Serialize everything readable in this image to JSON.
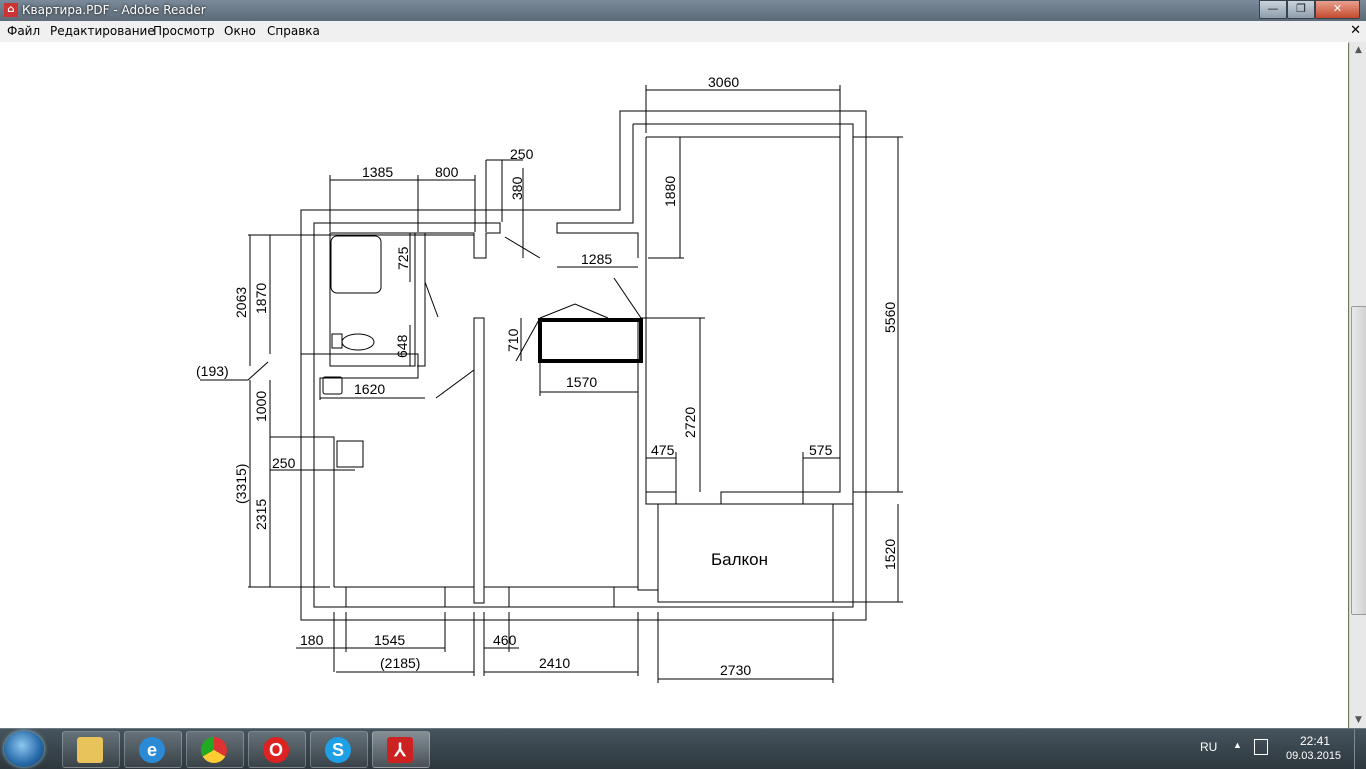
{
  "window": {
    "title": "Квартира.PDF - Adobe Reader",
    "icon": "pdf-icon"
  },
  "window_controls": {
    "minimize": "—",
    "maximize": "❐",
    "close": "✕"
  },
  "menu": [
    {
      "label": "Файл"
    },
    {
      "label": "Редактирование"
    },
    {
      "label": "Просмотр"
    },
    {
      "label": "Окно"
    },
    {
      "label": "Справка"
    }
  ],
  "doc_close": "✕",
  "plan": {
    "room_label": "Балкон",
    "dims": {
      "d3060": "3060",
      "d250a": "250",
      "d1385": "1385",
      "d800": "800",
      "d380": "380",
      "d1880": "1880",
      "d725": "725",
      "d1285": "1285",
      "d2063": "2063",
      "d1870": "1870",
      "d5560": "5560",
      "d710": "710",
      "d648": "648",
      "d193": "(193)",
      "d1620": "1620",
      "d1570": "1570",
      "d1000": "1000",
      "d2720": "2720",
      "d475": "475",
      "d575": "575",
      "d250b": "250",
      "d3315": "(3315)",
      "d2315": "2315",
      "d1520": "1520",
      "d180": "180",
      "d1545": "1545",
      "d460": "460",
      "d2185": "(2185)",
      "d2410": "2410",
      "d2730": "2730"
    }
  },
  "taskbar": {
    "apps": [
      {
        "name": "explorer-icon",
        "active": false
      },
      {
        "name": "ie-icon",
        "active": false
      },
      {
        "name": "chrome-icon",
        "active": false
      },
      {
        "name": "opera-icon",
        "active": false
      },
      {
        "name": "skype-icon",
        "active": false
      },
      {
        "name": "adobe-reader-icon",
        "active": true
      }
    ],
    "lang": "RU",
    "time": "22:41",
    "date": "09.03.2015"
  }
}
